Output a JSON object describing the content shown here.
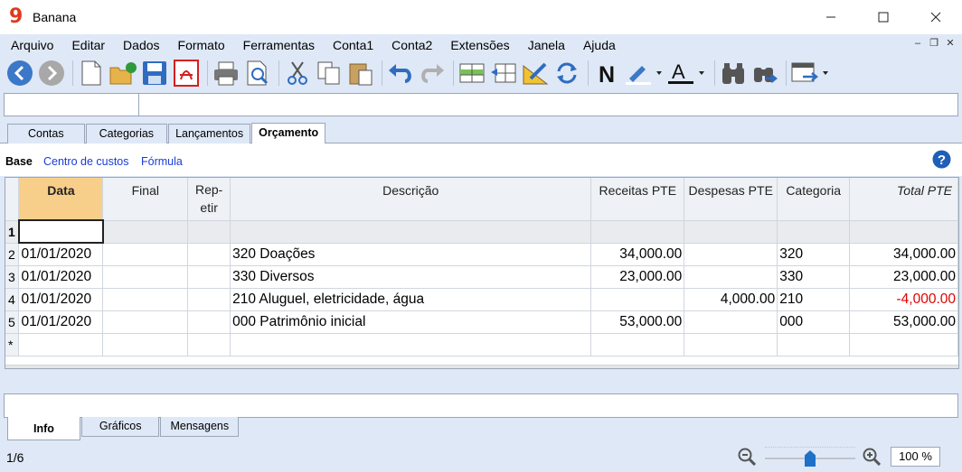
{
  "window": {
    "title": "Banana",
    "logo": "9"
  },
  "menu": [
    "Arquivo",
    "Editar",
    "Dados",
    "Formato",
    "Ferramentas",
    "Conta1",
    "Conta2",
    "Extensões",
    "Janela",
    "Ajuda"
  ],
  "toolbar_icons": [
    "back-icon",
    "forward-icon",
    "new-file-icon",
    "open-folder-icon",
    "save-icon",
    "pdf-icon",
    "print-icon",
    "print-preview-icon",
    "cut-icon",
    "copy-icon",
    "paste-icon",
    "undo-icon",
    "redo-icon",
    "insert-rows-icon",
    "delete-rows-icon",
    "edit-row-icon",
    "recalculate-icon",
    "bold-icon",
    "highlight-color-icon",
    "text-color-icon",
    "find-icon",
    "find-next-icon",
    "window-arrange-icon"
  ],
  "tabs": [
    "Contas",
    "Categorias",
    "Lançamentos",
    "Orçamento"
  ],
  "active_tab": "Orçamento",
  "views": {
    "base": "Base",
    "links": [
      "Centro de custos",
      "Fórmula"
    ]
  },
  "table": {
    "columns": [
      "Data",
      "Final",
      "Rep-\netir",
      "Descrição",
      "Receitas PTE",
      "Despesas PTE",
      "Categoria",
      "Total PTE"
    ],
    "rows": [
      {
        "n": "1",
        "data": "",
        "final": "",
        "repetir": "",
        "descricao": "",
        "receitas": "",
        "despesas": "",
        "categoria": "",
        "total": ""
      },
      {
        "n": "2",
        "data": "01/01/2020",
        "final": "",
        "repetir": "",
        "descricao": "320 Doações",
        "receitas": "34,000.00",
        "despesas": "",
        "categoria": "320",
        "total": "34,000.00"
      },
      {
        "n": "3",
        "data": "01/01/2020",
        "final": "",
        "repetir": "",
        "descricao": "330 Diversos",
        "receitas": "23,000.00",
        "despesas": "",
        "categoria": "330",
        "total": "23,000.00"
      },
      {
        "n": "4",
        "data": "01/01/2020",
        "final": "",
        "repetir": "",
        "descricao": "210 Aluguel, eletricidade, água",
        "receitas": "",
        "despesas": "4,000.00",
        "categoria": "210",
        "total": "-4,000.00"
      },
      {
        "n": "5",
        "data": "01/01/2020",
        "final": "",
        "repetir": "",
        "descricao": "000 Patrimônio inicial",
        "receitas": "53,000.00",
        "despesas": "",
        "categoria": "000",
        "total": "53,000.00"
      },
      {
        "n": "*",
        "data": "",
        "final": "",
        "repetir": "",
        "descricao": "",
        "receitas": "",
        "despesas": "",
        "categoria": "",
        "total": ""
      }
    ]
  },
  "bottom_tabs": [
    "Info",
    "Gráficos",
    "Mensagens"
  ],
  "status": {
    "page": "1/6",
    "zoom": "100 %",
    "zoom_level_percent": 100
  },
  "colors": {
    "accent": "#1e70c8",
    "negative": "#e00000",
    "selected_header": "#f7cf8b"
  }
}
